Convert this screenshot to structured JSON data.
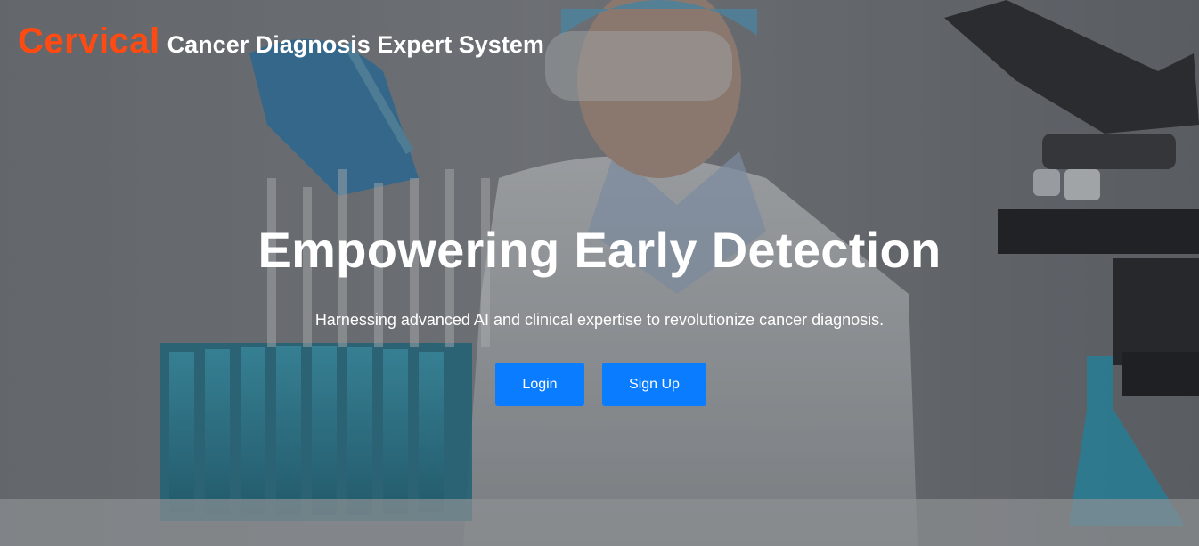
{
  "header": {
    "brand_accent": "Cervical",
    "brand_rest": "Cancer Diagnosis Expert System"
  },
  "hero": {
    "headline": "Empowering Early Detection",
    "subtitle": "Harnessing advanced AI and clinical expertise to revolutionize cancer diagnosis.",
    "login_label": "Login",
    "signup_label": "Sign Up",
    "background_image": "scientist-with-microscope-and-test-tubes-photo"
  },
  "colors": {
    "accent": "#ff4a12",
    "button": "#0a7cff",
    "text": "#ffffff"
  }
}
